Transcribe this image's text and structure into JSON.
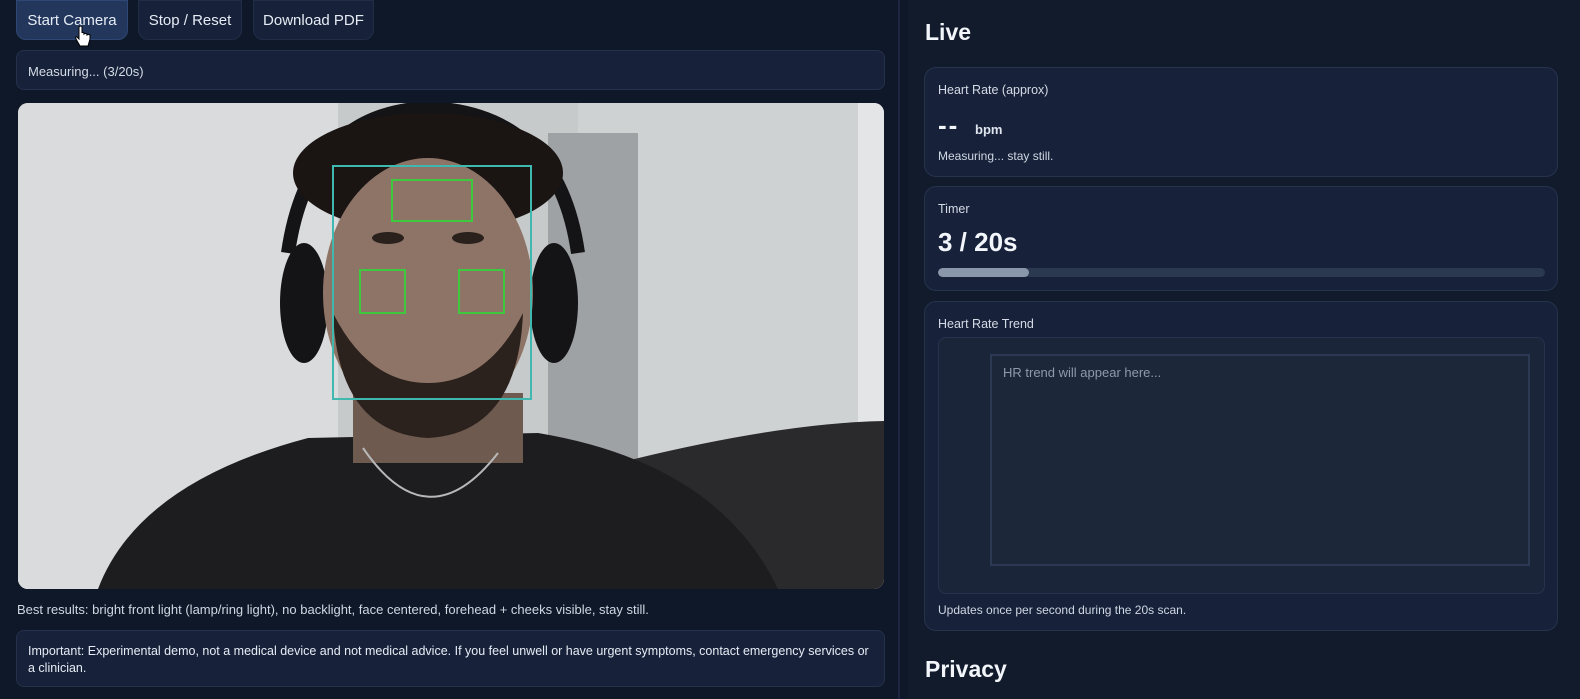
{
  "controls": {
    "start_label": "Start Camera",
    "stop_label": "Stop / Reset",
    "download_label": "Download PDF"
  },
  "status": {
    "text": "Measuring... (3/20s)"
  },
  "hint": {
    "text": "Best results: bright front light (lamp/ring light), no backlight, face centered, forehead + cheeks visible, stay still."
  },
  "disclaimer": {
    "text": "Important: Experimental demo, not a medical device and not medical advice. If you feel unwell or have urgent symptoms, contact emergency services or a clinician."
  },
  "live": {
    "heading": "Live",
    "heart_rate": {
      "label": "Heart Rate (approx)",
      "value": "--",
      "unit": "bpm",
      "note": "Measuring... stay still."
    },
    "timer": {
      "label": "Timer",
      "value": "3 / 20s",
      "progress_fraction": 0.15
    },
    "trend": {
      "label": "Heart Rate Trend",
      "placeholder": "HR trend will appear here...",
      "note": "Updates once per second during the 20s scan."
    }
  },
  "privacy": {
    "heading": "Privacy"
  },
  "colors": {
    "face_box": "#3fb8b0",
    "roi_box": "#3ec83e",
    "accent_button": "#23375d"
  }
}
